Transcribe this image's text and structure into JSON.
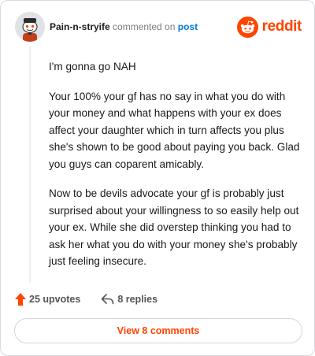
{
  "header": {
    "username": "Pain-n-stryife",
    "action_text": "commented on",
    "target_text": "post",
    "brand_name": "reddit"
  },
  "comment": {
    "paragraphs": [
      "I'm gonna go NAH",
      "Your 100% your gf has no say in what you do with your money and what happens with your ex does affect your daughter which in turn affects you plus she's shown to be good about paying you back. Glad you guys can coparent amicably.",
      "Now to be devils advocate your gf is probably just surprised about your willingness to so easily help out your ex. While she did overstep thinking you had to ask her what you do with your money she's probably just feeling insecure."
    ]
  },
  "footer": {
    "upvotes_label": "25 upvotes",
    "replies_label": "8 replies",
    "view_comments_label": "View 8 comments"
  },
  "colors": {
    "brand": "#ff4500",
    "link": "#0079d3",
    "muted": "#7c7c7c"
  },
  "icons": {
    "avatar": "snoo-avatar",
    "brand": "reddit-snoo-icon",
    "upvote": "upvote-arrow-icon",
    "reply": "reply-arrow-icon"
  }
}
